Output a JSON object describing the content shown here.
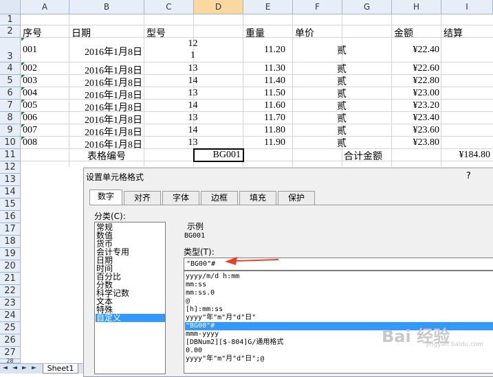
{
  "columns": [
    "A",
    "B",
    "C",
    "D",
    "E",
    "F",
    "G",
    "H",
    "I"
  ],
  "rows": [
    "1",
    "2",
    "3",
    "4",
    "5",
    "6",
    "7",
    "8",
    "9",
    "10",
    "11",
    "12",
    "13",
    "14",
    "15",
    "16",
    "17",
    "18",
    "19",
    "20",
    "21",
    "22",
    "23",
    "24",
    "25",
    "26",
    "27",
    "28"
  ],
  "header_row": {
    "a": "序号",
    "b": "日期",
    "c": "型号",
    "e": "重量",
    "f": "单价",
    "h": "金额",
    "i": "结算"
  },
  "data_rows": [
    {
      "a": "001",
      "b": "2016年1月8日",
      "c": "12",
      "c2": "1",
      "e": "11.20",
      "f": "贰",
      "h": "¥22.40"
    },
    {
      "a": "002",
      "b": "2016年1月8日",
      "c": "13",
      "e": "11.30",
      "f": "贰",
      "h": "¥22.60"
    },
    {
      "a": "003",
      "b": "2016年1月8日",
      "c": "14",
      "e": "11.40",
      "f": "贰",
      "h": "¥22.80"
    },
    {
      "a": "004",
      "b": "2016年1月8日",
      "c": "13",
      "e": "11.50",
      "f": "贰",
      "h": "¥23.00"
    },
    {
      "a": "005",
      "b": "2016年1月8日",
      "c": "14",
      "e": "11.60",
      "f": "贰",
      "h": "¥23.20"
    },
    {
      "a": "006",
      "b": "2016年1月8日",
      "c": "13",
      "e": "11.70",
      "f": "贰",
      "h": "¥23.40"
    },
    {
      "a": "007",
      "b": "2016年1月8日",
      "c": "14",
      "e": "11.80",
      "f": "贰",
      "h": "¥23.60"
    },
    {
      "a": "008",
      "b": "2016年1月8日",
      "c": "13",
      "e": "11.90",
      "f": "贰",
      "h": "¥23.80"
    }
  ],
  "row11": {
    "b": "表格编号",
    "d": "BG001",
    "g": "合计金额",
    "i": "¥184.80"
  },
  "sheet_tab": "Sheet1",
  "tab_nav": [
    "◄",
    "◄",
    "►",
    "►"
  ],
  "dialog": {
    "title": "设置单元格格式",
    "help": "?",
    "tabs": [
      "数字",
      "对齐",
      "字体",
      "边框",
      "填充",
      "保护"
    ],
    "category_label": "分类(C):",
    "categories": [
      "常规",
      "数值",
      "货币",
      "会计专用",
      "日期",
      "时间",
      "百分比",
      "分数",
      "科学记数",
      "文本",
      "特殊",
      "自定义"
    ],
    "selected_category": "自定义",
    "sample_label": "示例",
    "sample_value": "BG001",
    "type_label": "类型(T):",
    "type_value": "\"BG00\"#",
    "formats": [
      "yyyy/m/d h:mm",
      "mm:ss",
      "mm:ss.0",
      "@",
      "[h]:mm:ss",
      "yyyy\"年\"m\"月\"d\"日\"",
      "\"BG00\"#",
      "mmm-yyyy",
      "[DBNum2][$-804]G/通用格式",
      "0.00",
      "yyyy\"年\"m\"月\"d\"日\";@"
    ],
    "selected_format": "\"BG00\"#"
  },
  "arrow_color": "#e8402a",
  "watermark": "Bai 经验",
  "watermark_sub": "jingyan.baidu.com"
}
